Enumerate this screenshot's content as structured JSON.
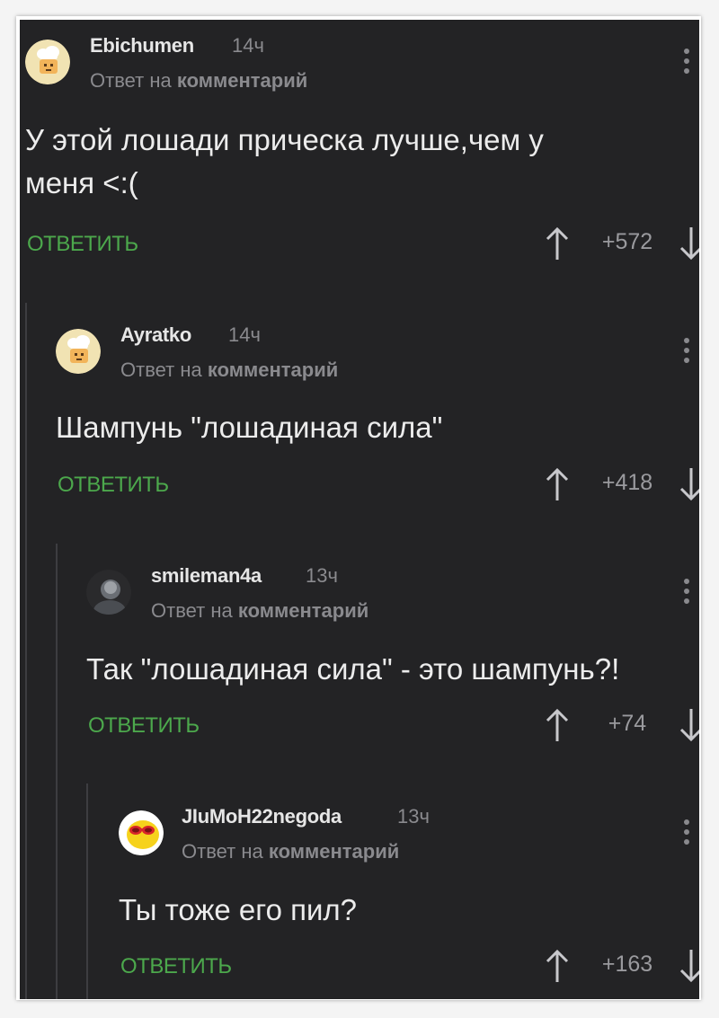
{
  "reply_context_prefix": "Ответ на",
  "reply_context_target": "комментарий",
  "reply_label": "ОТВЕТИТЬ",
  "accent_color": "#4ca84c",
  "background_color": "#232325",
  "comments": [
    {
      "username": "Ebichumen",
      "time": "14ч",
      "text_line1": "У этой лошади прическа лучше,чем у",
      "text_line2": "меня <:(",
      "score": "+572",
      "avatar_icon": "chef-hat-avatar"
    },
    {
      "username": "Ayratko",
      "time": "14ч",
      "text_line1": "Шампунь \"лошадиная сила\"",
      "score": "+418",
      "avatar_icon": "chef-hat-avatar"
    },
    {
      "username": "smileman4a",
      "time": "13ч",
      "text_line1": "Так \"лошадиная сила\" - это шампунь?!",
      "score": "+74",
      "avatar_icon": "photo-avatar"
    },
    {
      "username": "JIuMoH22negoda",
      "time": "13ч",
      "text_line1": "Ты тоже его пил?",
      "score": "+163",
      "avatar_icon": "lemon-sunglasses-avatar"
    }
  ]
}
